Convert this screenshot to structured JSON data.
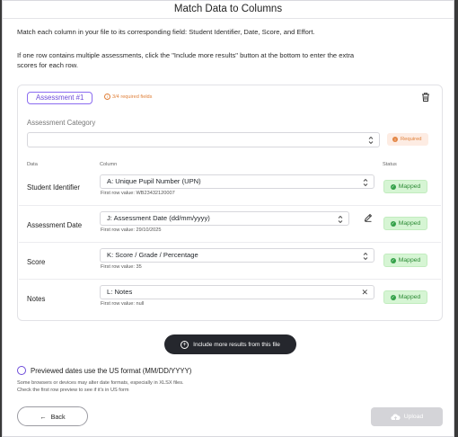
{
  "header": {
    "title": "Match Data to Columns"
  },
  "intro": {
    "line1": "Match each column in your file to its corresponding field: Student Identifier, Date, Score, and Effort.",
    "line2a": "If one row contains multiple assessments, click the \"Include more results\" button at the bottom to enter the extra",
    "line2b": "scores for each row."
  },
  "assessment": {
    "chip_label": "Assessment #1",
    "required_fields": "3/4 required fields",
    "category_label": "Assessment Category",
    "category_value": "",
    "category_status": "Required"
  },
  "table": {
    "headers": {
      "data": "Data",
      "column": "Column",
      "status": "Status"
    },
    "rows": [
      {
        "label": "Student Identifier",
        "column": "A: Unique Pupil Number (UPN)",
        "first_row": "First row value: WB23432120007",
        "status": "Mapped"
      },
      {
        "label": "Assessment Date",
        "column": "J: Assessment Date (dd/mm/yyyy)",
        "first_row": "First row value: 29/10/2025",
        "status": "Mapped"
      },
      {
        "label": "Score",
        "column": "K: Score / Grade / Percentage",
        "first_row": "First row value: 35",
        "status": "Mapped"
      },
      {
        "label": "Notes",
        "column": "L: Notes",
        "first_row": "First row value: null",
        "status": "Mapped"
      }
    ]
  },
  "include_more_label": "Include more results from this file",
  "us_format": {
    "label": "Previewed dates use the US format (MM/DD/YYYY)",
    "hint1": "Some browsers or devices may alter date formats, especially in XLSX files.",
    "hint2": "Check the first row preview to see if it's in US form"
  },
  "footer": {
    "back_label": "Back",
    "upload_label": "Upload"
  },
  "colors": {
    "accent": "#6d4bd9",
    "warning": "#e0803a",
    "success": "#2c8a35",
    "dark_button": "#25272d"
  }
}
